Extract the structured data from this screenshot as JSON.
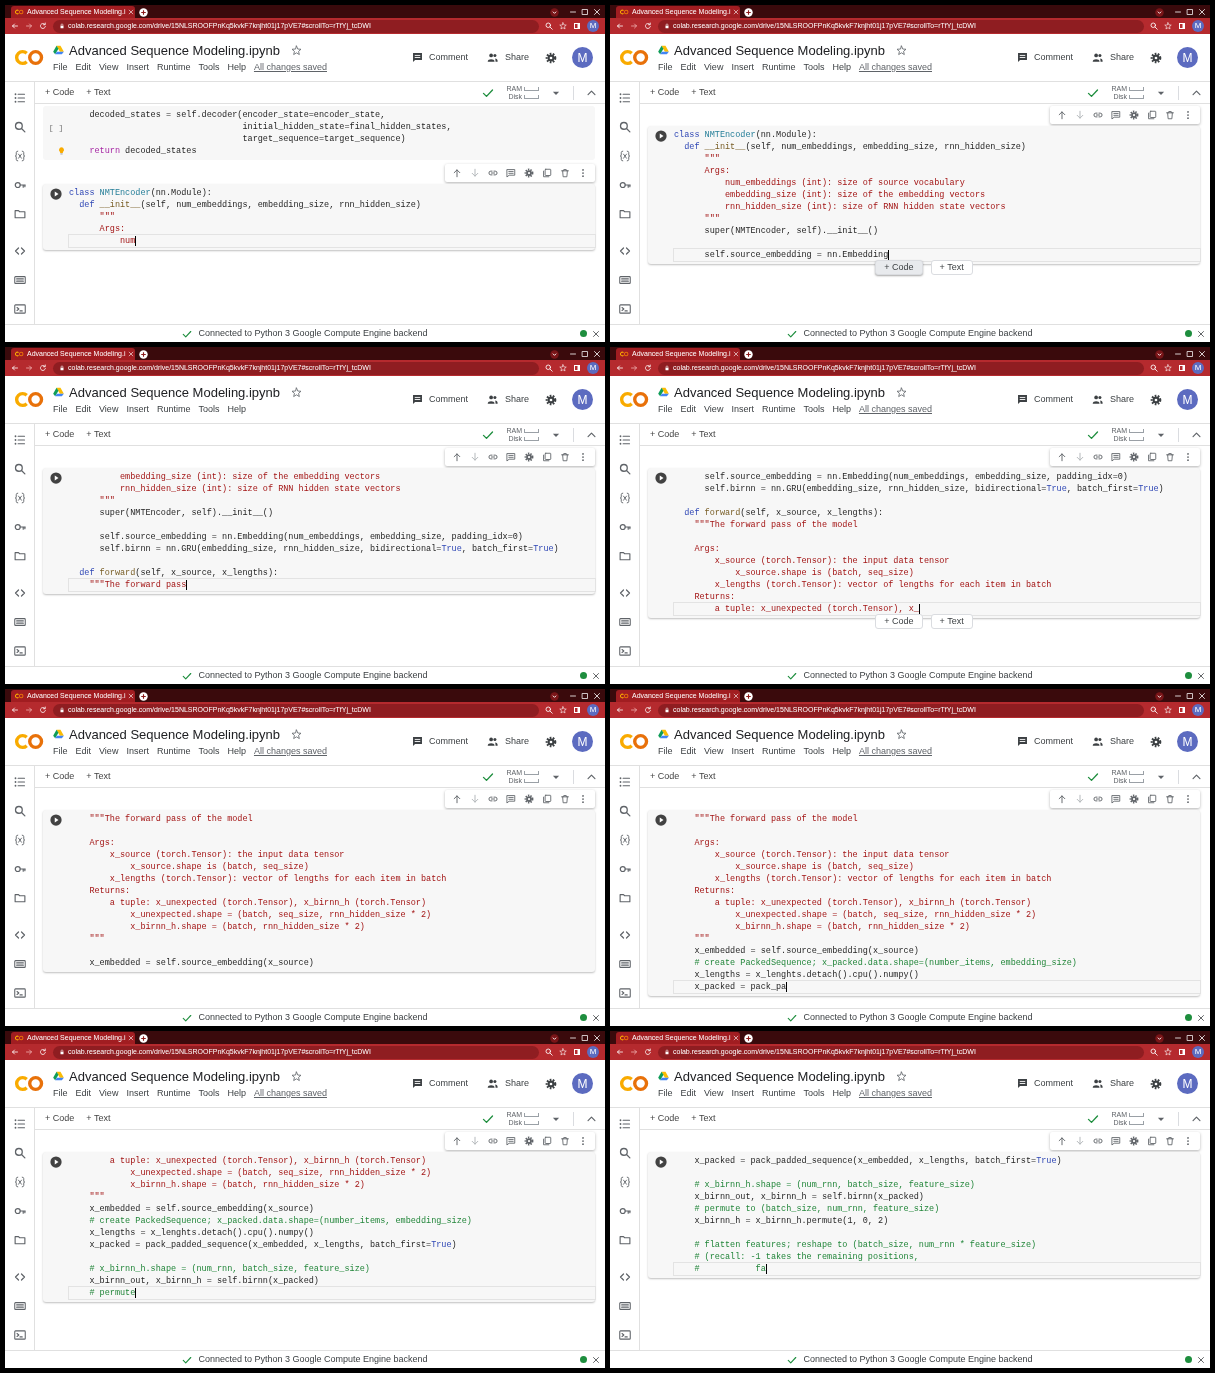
{
  "frames": [
    {
      "browser": {
        "tab_title": "Advanced Sequence Modeling.i",
        "url": "colab.research.google.com/drive/15NLSROOFPnKq5kvkF7knjht01j17pVE7#scrollTo=rTfYj_tcDWI",
        "avatar": "M"
      },
      "header": {
        "title": "Advanced Sequence Modeling.ipynb",
        "menu": [
          "File",
          "Edit",
          "View",
          "Insert",
          "Runtime",
          "Tools",
          "Help"
        ],
        "save_status": "All changes saved",
        "comment": "Comment",
        "share": "Share",
        "avatar": "M"
      },
      "toolbar": {
        "add_code": "+ Code",
        "add_text": "+ Text",
        "ram": "RAM",
        "disk": "Disk"
      },
      "cells": [
        {
          "active": false,
          "execution_count": "[ ]",
          "hint": true,
          "cursor": false,
          "lines": [
            {
              "kind": "code",
              "parts": [
                {
                  "kind": "plain",
                  "text": "    decoded_states = self.decoder(encoder_state=encoder_state,"
                }
              ]
            },
            {
              "kind": "code",
              "parts": [
                {
                  "kind": "plain",
                  "text": "                                  initial_hidden_state=final_hidden_states,"
                }
              ]
            },
            {
              "kind": "code",
              "parts": [
                {
                  "kind": "plain",
                  "text": "                                  target_sequence=target_sequence)"
                }
              ]
            },
            {
              "kind": "code",
              "parts": [
                {
                  "kind": "ctrl",
                  "text": "    return"
                },
                {
                  "kind": "plain",
                  "text": " decoded_states"
                }
              ]
            }
          ]
        },
        {
          "active": true,
          "hint": false,
          "cursor": true,
          "lines": [
            {
              "kind": "code",
              "parts": [
                {
                  "kind": "kw",
                  "text": "class "
                },
                {
                  "kind": "cls",
                  "text": "NMTEncoder"
                },
                {
                  "kind": "plain",
                  "text": "(nn.Module):"
                }
              ]
            },
            {
              "kind": "code",
              "parts": [
                {
                  "kind": "kw",
                  "text": "  def "
                },
                {
                  "kind": "fn",
                  "text": "__init__"
                },
                {
                  "kind": "plain",
                  "text": "(self, num_embeddings, embedding_size, rnn_hidden_size)"
                }
              ]
            },
            {
              "kind": "code",
              "parts": [
                {
                  "kind": "str",
                  "text": "      \"\"\""
                }
              ]
            },
            {
              "kind": "code",
              "parts": [
                {
                  "kind": "str",
                  "text": "      Args:"
                }
              ]
            },
            {
              "kind": "code",
              "parts": [
                {
                  "kind": "str",
                  "text": "          num"
                }
              ]
            }
          ]
        }
      ],
      "status_bar": {
        "text": "Connected to Python 3 Google Compute Engine backend"
      }
    },
    {
      "browser": {
        "tab_title": "Advanced Sequence Modeling.i",
        "url": "colab.research.google.com/drive/15NLSROOFPnKq5kvkF7knjht01j17pVE7#scrollTo=rTfYj_tcDWI",
        "avatar": "M"
      },
      "header": {
        "title": "Advanced Sequence Modeling.ipynb",
        "menu": [
          "File",
          "Edit",
          "View",
          "Insert",
          "Runtime",
          "Tools",
          "Help"
        ],
        "save_status": "All changes saved",
        "comment": "Comment",
        "share": "Share",
        "avatar": "M"
      },
      "toolbar": {
        "add_code": "+ Code",
        "add_text": "+ Text",
        "ram": "RAM",
        "disk": "Disk"
      },
      "cells": [
        {
          "active": true,
          "hint": false,
          "cursor": true,
          "lines": [
            {
              "kind": "code",
              "parts": [
                {
                  "kind": "kw",
                  "text": "class "
                },
                {
                  "kind": "cls",
                  "text": "NMTEncoder"
                },
                {
                  "kind": "plain",
                  "text": "(nn.Module):"
                }
              ]
            },
            {
              "kind": "code",
              "parts": [
                {
                  "kind": "kw",
                  "text": "  def "
                },
                {
                  "kind": "fn",
                  "text": "__init__"
                },
                {
                  "kind": "plain",
                  "text": "(self, num_embeddings, embedding_size, rnn_hidden_size)"
                }
              ]
            },
            {
              "kind": "code",
              "parts": [
                {
                  "kind": "str",
                  "text": "      \"\"\""
                }
              ]
            },
            {
              "kind": "code",
              "parts": [
                {
                  "kind": "str",
                  "text": "      Args:"
                }
              ]
            },
            {
              "kind": "code",
              "parts": [
                {
                  "kind": "str",
                  "text": "          num_embeddings (int): size of source vocabulary"
                }
              ]
            },
            {
              "kind": "code",
              "parts": [
                {
                  "kind": "str",
                  "text": "          embedding_size (int): size of the embedding vectors"
                }
              ]
            },
            {
              "kind": "code",
              "parts": [
                {
                  "kind": "str",
                  "text": "          rnn_hidden_size (int): size of RNN hidden state vectors"
                }
              ]
            },
            {
              "kind": "code",
              "parts": [
                {
                  "kind": "str",
                  "text": "      \"\"\""
                }
              ]
            },
            {
              "kind": "code",
              "parts": [
                {
                  "kind": "plain",
                  "text": "      super(NMTEncoder, self).__init__()"
                }
              ]
            },
            {
              "kind": "blank"
            },
            {
              "kind": "code",
              "parts": [
                {
                  "kind": "plain",
                  "text": "      self.source_embedding = nn.Embedding"
                }
              ]
            }
          ]
        }
      ],
      "insert_buttons": [
        {
          "label": "+ Code",
          "selected": true
        },
        {
          "label": "+ Text",
          "selected": false
        }
      ],
      "status_bar": {
        "text": "Connected to Python 3 Google Compute Engine backend"
      }
    },
    {
      "browser": {
        "tab_title": "Advanced Sequence Modeling.i",
        "url": "colab.research.google.com/drive/15NLSROOFPnKq5kvkF7knjht01j17pVE7#scrollTo=rTfYj_tcDWI",
        "avatar": "M"
      },
      "header": {
        "title": "Advanced Sequence Modeling.ipynb",
        "menu": [
          "File",
          "Edit",
          "View",
          "Insert",
          "Runtime",
          "Tools",
          "Help"
        ],
        "comment": "Comment",
        "share": "Share",
        "avatar": "M"
      },
      "toolbar": {
        "add_code": "+ Code",
        "add_text": "+ Text",
        "ram": "RAM",
        "disk": "Disk"
      },
      "cells": [
        {
          "active": true,
          "hint": false,
          "cursor": true,
          "lines": [
            {
              "kind": "code",
              "parts": [
                {
                  "kind": "str",
                  "text": "          embedding_size (int): size of the embedding vectors"
                }
              ]
            },
            {
              "kind": "code",
              "parts": [
                {
                  "kind": "str",
                  "text": "          rnn_hidden_size (int): size of RNN hidden state vectors"
                }
              ]
            },
            {
              "kind": "code",
              "parts": [
                {
                  "kind": "str",
                  "text": "      \"\"\""
                }
              ]
            },
            {
              "kind": "code",
              "parts": [
                {
                  "kind": "plain",
                  "text": "      super(NMTEncoder, self).__init__()"
                }
              ]
            },
            {
              "kind": "blank"
            },
            {
              "kind": "code",
              "parts": [
                {
                  "kind": "plain",
                  "text": "      self.source_embedding = nn.Embedding(num_embeddings, embedding_size, padding_idx=0)"
                }
              ]
            },
            {
              "kind": "code",
              "parts": [
                {
                  "kind": "plain",
                  "text": "      self.birnn = nn.GRU(embedding_size, rnn_hidden_size, bidirectional="
                },
                {
                  "kind": "kw",
                  "text": "True"
                },
                {
                  "kind": "plain",
                  "text": ", batch_first="
                },
                {
                  "kind": "kw",
                  "text": "True"
                },
                {
                  "kind": "plain",
                  "text": ")"
                }
              ]
            },
            {
              "kind": "blank"
            },
            {
              "kind": "code",
              "parts": [
                {
                  "kind": "kw",
                  "text": "  def "
                },
                {
                  "kind": "fn",
                  "text": "forward"
                },
                {
                  "kind": "plain",
                  "text": "(self, x_source, x_lengths):"
                }
              ]
            },
            {
              "kind": "code",
              "parts": [
                {
                  "kind": "str",
                  "text": "    \"\"\"The forward pass"
                }
              ]
            }
          ]
        }
      ],
      "status_bar": {
        "text": "Connected to Python 3 Google Compute Engine backend"
      }
    },
    {
      "browser": {
        "tab_title": "Advanced Sequence Modeling.i",
        "url": "colab.research.google.com/drive/15NLSROOFPnKq5kvkF7knjht01j17pVE7#scrollTo=rTfYj_tcDWI",
        "avatar": "M"
      },
      "header": {
        "title": "Advanced Sequence Modeling.ipynb",
        "menu": [
          "File",
          "Edit",
          "View",
          "Insert",
          "Runtime",
          "Tools",
          "Help"
        ],
        "save_status": "All changes saved",
        "comment": "Comment",
        "share": "Share",
        "avatar": "M"
      },
      "toolbar": {
        "add_code": "+ Code",
        "add_text": "+ Text",
        "ram": "RAM",
        "disk": "Disk"
      },
      "cells": [
        {
          "active": true,
          "hint": false,
          "cursor": true,
          "lines": [
            {
              "kind": "code",
              "parts": [
                {
                  "kind": "plain",
                  "text": "      self.source_embedding = nn.Embedding(num_embeddings, embedding_size, padding_idx=0)"
                }
              ]
            },
            {
              "kind": "code",
              "parts": [
                {
                  "kind": "plain",
                  "text": "      self.birnn = nn.GRU(embedding_size, rnn_hidden_size, bidirectional="
                },
                {
                  "kind": "kw",
                  "text": "True"
                },
                {
                  "kind": "plain",
                  "text": ", batch_first="
                },
                {
                  "kind": "kw",
                  "text": "True"
                },
                {
                  "kind": "plain",
                  "text": ")"
                }
              ]
            },
            {
              "kind": "blank"
            },
            {
              "kind": "code",
              "parts": [
                {
                  "kind": "kw",
                  "text": "  def "
                },
                {
                  "kind": "fn",
                  "text": "forward"
                },
                {
                  "kind": "plain",
                  "text": "(self, x_source, x_lengths):"
                }
              ]
            },
            {
              "kind": "code",
              "parts": [
                {
                  "kind": "str",
                  "text": "    \"\"\"The forward pass of the model"
                }
              ]
            },
            {
              "kind": "blank"
            },
            {
              "kind": "code",
              "parts": [
                {
                  "kind": "str",
                  "text": "    Args:"
                }
              ]
            },
            {
              "kind": "code",
              "parts": [
                {
                  "kind": "str",
                  "text": "        x_source (torch.Tensor): the input data tensor"
                }
              ]
            },
            {
              "kind": "code",
              "parts": [
                {
                  "kind": "str",
                  "text": "            x_source.shape is (batch, seq_size)"
                }
              ]
            },
            {
              "kind": "code",
              "parts": [
                {
                  "kind": "str",
                  "text": "        x_lengths (torch.Tensor): vector of lengths for each item in batch"
                }
              ]
            },
            {
              "kind": "code",
              "parts": [
                {
                  "kind": "str",
                  "text": "    Returns:"
                }
              ]
            },
            {
              "kind": "code",
              "parts": [
                {
                  "kind": "str",
                  "text": "        a tuple: x_unexpected (torch.Tensor), x_"
                }
              ]
            }
          ]
        }
      ],
      "insert_buttons": [
        {
          "label": "+ Code",
          "selected": false
        },
        {
          "label": "+ Text",
          "selected": false
        }
      ],
      "status_bar": {
        "text": "Connected to Python 3 Google Compute Engine backend"
      }
    },
    {
      "browser": {
        "tab_title": "Advanced Sequence Modeling.i",
        "url": "colab.research.google.com/drive/15NLSROOFPnKq5kvkF7knjht01j17pVE7#scrollTo=rTfYj_tcDWI",
        "avatar": "M"
      },
      "header": {
        "title": "Advanced Sequence Modeling.ipynb",
        "menu": [
          "File",
          "Edit",
          "View",
          "Insert",
          "Runtime",
          "Tools",
          "Help"
        ],
        "save_status": "All changes saved",
        "comment": "Comment",
        "share": "Share",
        "avatar": "M"
      },
      "toolbar": {
        "add_code": "+ Code",
        "add_text": "+ Text",
        "ram": "RAM",
        "disk": "Disk"
      },
      "cells": [
        {
          "active": true,
          "hint": false,
          "cursor": false,
          "lines": [
            {
              "kind": "code",
              "parts": [
                {
                  "kind": "str",
                  "text": "    \"\"\"The forward pass of the model"
                }
              ]
            },
            {
              "kind": "blank"
            },
            {
              "kind": "code",
              "parts": [
                {
                  "kind": "str",
                  "text": "    Args:"
                }
              ]
            },
            {
              "kind": "code",
              "parts": [
                {
                  "kind": "str",
                  "text": "        x_source (torch.Tensor): the input data tensor"
                }
              ]
            },
            {
              "kind": "code",
              "parts": [
                {
                  "kind": "str",
                  "text": "            x_source.shape is (batch, seq_size)"
                }
              ]
            },
            {
              "kind": "code",
              "parts": [
                {
                  "kind": "str",
                  "text": "        x_lengths (torch.Tensor): vector of lengths for each item in batch"
                }
              ]
            },
            {
              "kind": "code",
              "parts": [
                {
                  "kind": "str",
                  "text": "    Returns:"
                }
              ]
            },
            {
              "kind": "code",
              "parts": [
                {
                  "kind": "str",
                  "text": "        a tuple: x_unexpected (torch.Tensor), x_birnn_h (torch.Tensor)"
                }
              ]
            },
            {
              "kind": "code",
              "parts": [
                {
                  "kind": "str",
                  "text": "            x_unexpected.shape = (batch, seq_size, rnn_hidden_size * 2)"
                }
              ]
            },
            {
              "kind": "code",
              "parts": [
                {
                  "kind": "str",
                  "text": "            x_birnn_h.shape = (batch, rnn_hidden_size * 2)"
                }
              ]
            },
            {
              "kind": "code",
              "parts": [
                {
                  "kind": "str",
                  "text": "    \"\"\""
                }
              ]
            },
            {
              "kind": "blank"
            },
            {
              "kind": "code",
              "parts": [
                {
                  "kind": "plain",
                  "text": "    x_embedded = self.source_embedding(x_source)"
                }
              ]
            }
          ]
        }
      ],
      "status_bar": {
        "text": "Connected to Python 3 Google Compute Engine backend"
      }
    },
    {
      "browser": {
        "tab_title": "Advanced Sequence Modeling.i",
        "url": "colab.research.google.com/drive/15NLSROOFPnKq5kvkF7knjht01j17pVE7#scrollTo=rTfYj_tcDWI",
        "avatar": "M"
      },
      "header": {
        "title": "Advanced Sequence Modeling.ipynb",
        "menu": [
          "File",
          "Edit",
          "View",
          "Insert",
          "Runtime",
          "Tools",
          "Help"
        ],
        "save_status": "All changes saved",
        "comment": "Comment",
        "share": "Share",
        "avatar": "M"
      },
      "toolbar": {
        "add_code": "+ Code",
        "add_text": "+ Text",
        "ram": "RAM",
        "disk": "Disk"
      },
      "cells": [
        {
          "active": true,
          "hint": false,
          "cursor": true,
          "lines": [
            {
              "kind": "code",
              "parts": [
                {
                  "kind": "str",
                  "text": "    \"\"\"The forward pass of the model"
                }
              ]
            },
            {
              "kind": "blank"
            },
            {
              "kind": "code",
              "parts": [
                {
                  "kind": "str",
                  "text": "    Args:"
                }
              ]
            },
            {
              "kind": "code",
              "parts": [
                {
                  "kind": "str",
                  "text": "        x_source (torch.Tensor): the input data tensor"
                }
              ]
            },
            {
              "kind": "code",
              "parts": [
                {
                  "kind": "str",
                  "text": "            x_source.shape is (batch, seq_size)"
                }
              ]
            },
            {
              "kind": "code",
              "parts": [
                {
                  "kind": "str",
                  "text": "        x_lengths (torch.Tensor): vector of lengths for each item in batch"
                }
              ]
            },
            {
              "kind": "code",
              "parts": [
                {
                  "kind": "str",
                  "text": "    Returns:"
                }
              ]
            },
            {
              "kind": "code",
              "parts": [
                {
                  "kind": "str",
                  "text": "        a tuple: x_unexpected (torch.Tensor), x_birnn_h (torch.Tensor)"
                }
              ]
            },
            {
              "kind": "code",
              "parts": [
                {
                  "kind": "str",
                  "text": "            x_unexpected.shape = (batch, seq_size, rnn_hidden_size * 2)"
                }
              ]
            },
            {
              "kind": "code",
              "parts": [
                {
                  "kind": "str",
                  "text": "            x_birnn_h.shape = (batch, rnn_hidden_size * 2)"
                }
              ]
            },
            {
              "kind": "code",
              "parts": [
                {
                  "kind": "str",
                  "text": "    \"\"\""
                }
              ]
            },
            {
              "kind": "code",
              "parts": [
                {
                  "kind": "plain",
                  "text": "    x_embedded = self.source_embedding(x_source)"
                }
              ]
            },
            {
              "kind": "code",
              "parts": [
                {
                  "kind": "com",
                  "text": "    # create PackedSequence; x_packed.data.shape=(number_items, embedding_size)"
                }
              ]
            },
            {
              "kind": "code",
              "parts": [
                {
                  "kind": "plain",
                  "text": "    x_lengths = x_lenghts.detach().cpu().numpy()"
                }
              ]
            },
            {
              "kind": "code",
              "parts": [
                {
                  "kind": "plain",
                  "text": "    x_packed = pack_pa"
                }
              ]
            }
          ]
        }
      ],
      "status_bar": {
        "text": "Connected to Python 3 Google Compute Engine backend"
      }
    },
    {
      "browser": {
        "tab_title": "Advanced Sequence Modeling.i",
        "url": "colab.research.google.com/drive/15NLSROOFPnKq5kvkF7knjht01j17pVE7#scrollTo=rTfYj_tcDWI",
        "avatar": "M"
      },
      "header": {
        "title": "Advanced Sequence Modeling.ipynb",
        "menu": [
          "File",
          "Edit",
          "View",
          "Insert",
          "Runtime",
          "Tools",
          "Help"
        ],
        "save_status": "All changes saved",
        "comment": "Comment",
        "share": "Share",
        "avatar": "M"
      },
      "toolbar": {
        "add_code": "+ Code",
        "add_text": "+ Text",
        "ram": "RAM",
        "disk": "Disk"
      },
      "cells": [
        {
          "active": true,
          "hint": false,
          "cursor": true,
          "lines": [
            {
              "kind": "code",
              "parts": [
                {
                  "kind": "str",
                  "text": "        a tuple: x_unexpected (torch.Tensor), x_birnn_h (torch.Tensor)"
                }
              ]
            },
            {
              "kind": "code",
              "parts": [
                {
                  "kind": "str",
                  "text": "            x_unexpected.shape = (batch, seq_size, rnn_hidden_size * 2)"
                }
              ]
            },
            {
              "kind": "code",
              "parts": [
                {
                  "kind": "str",
                  "text": "            x_birnn_h.shape = (batch, rnn_hidden_size * 2)"
                }
              ]
            },
            {
              "kind": "code",
              "parts": [
                {
                  "kind": "str",
                  "text": "    \"\"\""
                }
              ]
            },
            {
              "kind": "code",
              "parts": [
                {
                  "kind": "plain",
                  "text": "    x_embedded = self.source_embedding(x_source)"
                }
              ]
            },
            {
              "kind": "code",
              "parts": [
                {
                  "kind": "com",
                  "text": "    # create PackedSequence; x_packed.data.shape=(number_items, embedding_size)"
                }
              ]
            },
            {
              "kind": "code",
              "parts": [
                {
                  "kind": "plain",
                  "text": "    x_lengths = x_lenghts.detach().cpu().numpy()"
                }
              ]
            },
            {
              "kind": "code",
              "parts": [
                {
                  "kind": "plain",
                  "text": "    x_packed = pack_padded_sequence(x_embedded, x_lengths, batch_first="
                },
                {
                  "kind": "kw",
                  "text": "True"
                },
                {
                  "kind": "plain",
                  "text": ")"
                }
              ]
            },
            {
              "kind": "blank"
            },
            {
              "kind": "code",
              "parts": [
                {
                  "kind": "com",
                  "text": "    # x_birnn_h.shape = (num_rnn, batch_size, feature_size)"
                }
              ]
            },
            {
              "kind": "code",
              "parts": [
                {
                  "kind": "plain",
                  "text": "    x_birnn_out, x_birnn_h = self.birnn(x_packed)"
                }
              ]
            },
            {
              "kind": "code",
              "parts": [
                {
                  "kind": "com",
                  "text": "    # permute"
                }
              ]
            }
          ]
        }
      ],
      "status_bar": {
        "text": "Connected to Python 3 Google Compute Engine backend"
      }
    },
    {
      "browser": {
        "tab_title": "Advanced Sequence Modeling.i",
        "url": "colab.research.google.com/drive/15NLSROOFPnKq5kvkF7knjht01j17pVE7#scrollTo=rTfYj_tcDWI",
        "avatar": "M"
      },
      "header": {
        "title": "Advanced Sequence Modeling.ipynb",
        "menu": [
          "File",
          "Edit",
          "View",
          "Insert",
          "Runtime",
          "Tools",
          "Help"
        ],
        "save_status": "All changes saved",
        "comment": "Comment",
        "share": "Share",
        "avatar": "M"
      },
      "toolbar": {
        "add_code": "+ Code",
        "add_text": "+ Text",
        "ram": "RAM",
        "disk": "Disk"
      },
      "cells": [
        {
          "active": true,
          "hint": false,
          "cursor": true,
          "lines": [
            {
              "kind": "code",
              "parts": [
                {
                  "kind": "plain",
                  "text": "    x_packed = pack_padded_sequence(x_embedded, x_lengths, batch_first="
                },
                {
                  "kind": "kw",
                  "text": "True"
                },
                {
                  "kind": "plain",
                  "text": ")"
                }
              ]
            },
            {
              "kind": "blank"
            },
            {
              "kind": "code",
              "parts": [
                {
                  "kind": "com",
                  "text": "    # x_birnn_h.shape = (num_rnn, batch_size, feature_size)"
                }
              ]
            },
            {
              "kind": "code",
              "parts": [
                {
                  "kind": "plain",
                  "text": "    x_birnn_out, x_birnn_h = self.birnn(x_packed)"
                }
              ]
            },
            {
              "kind": "code",
              "parts": [
                {
                  "kind": "com",
                  "text": "    # permute to (batch_size, num_rnn, feature_size)"
                }
              ]
            },
            {
              "kind": "code",
              "parts": [
                {
                  "kind": "plain",
                  "text": "    x_birnn_h = x_birnn_h.permute(1, 0, 2)"
                }
              ]
            },
            {
              "kind": "blank"
            },
            {
              "kind": "code",
              "parts": [
                {
                  "kind": "com",
                  "text": "    # flatten features; reshape to (batch_size, num_rnn * feature_size)"
                }
              ]
            },
            {
              "kind": "code",
              "parts": [
                {
                  "kind": "com",
                  "text": "    # (recall: -1 takes the remaining positions,"
                }
              ]
            },
            {
              "kind": "code",
              "parts": [
                {
                  "kind": "com",
                  "text": "    #           fa"
                }
              ]
            }
          ]
        }
      ],
      "status_bar": {
        "text": "Connected to Python 3 Google Compute Engine backend"
      }
    }
  ]
}
